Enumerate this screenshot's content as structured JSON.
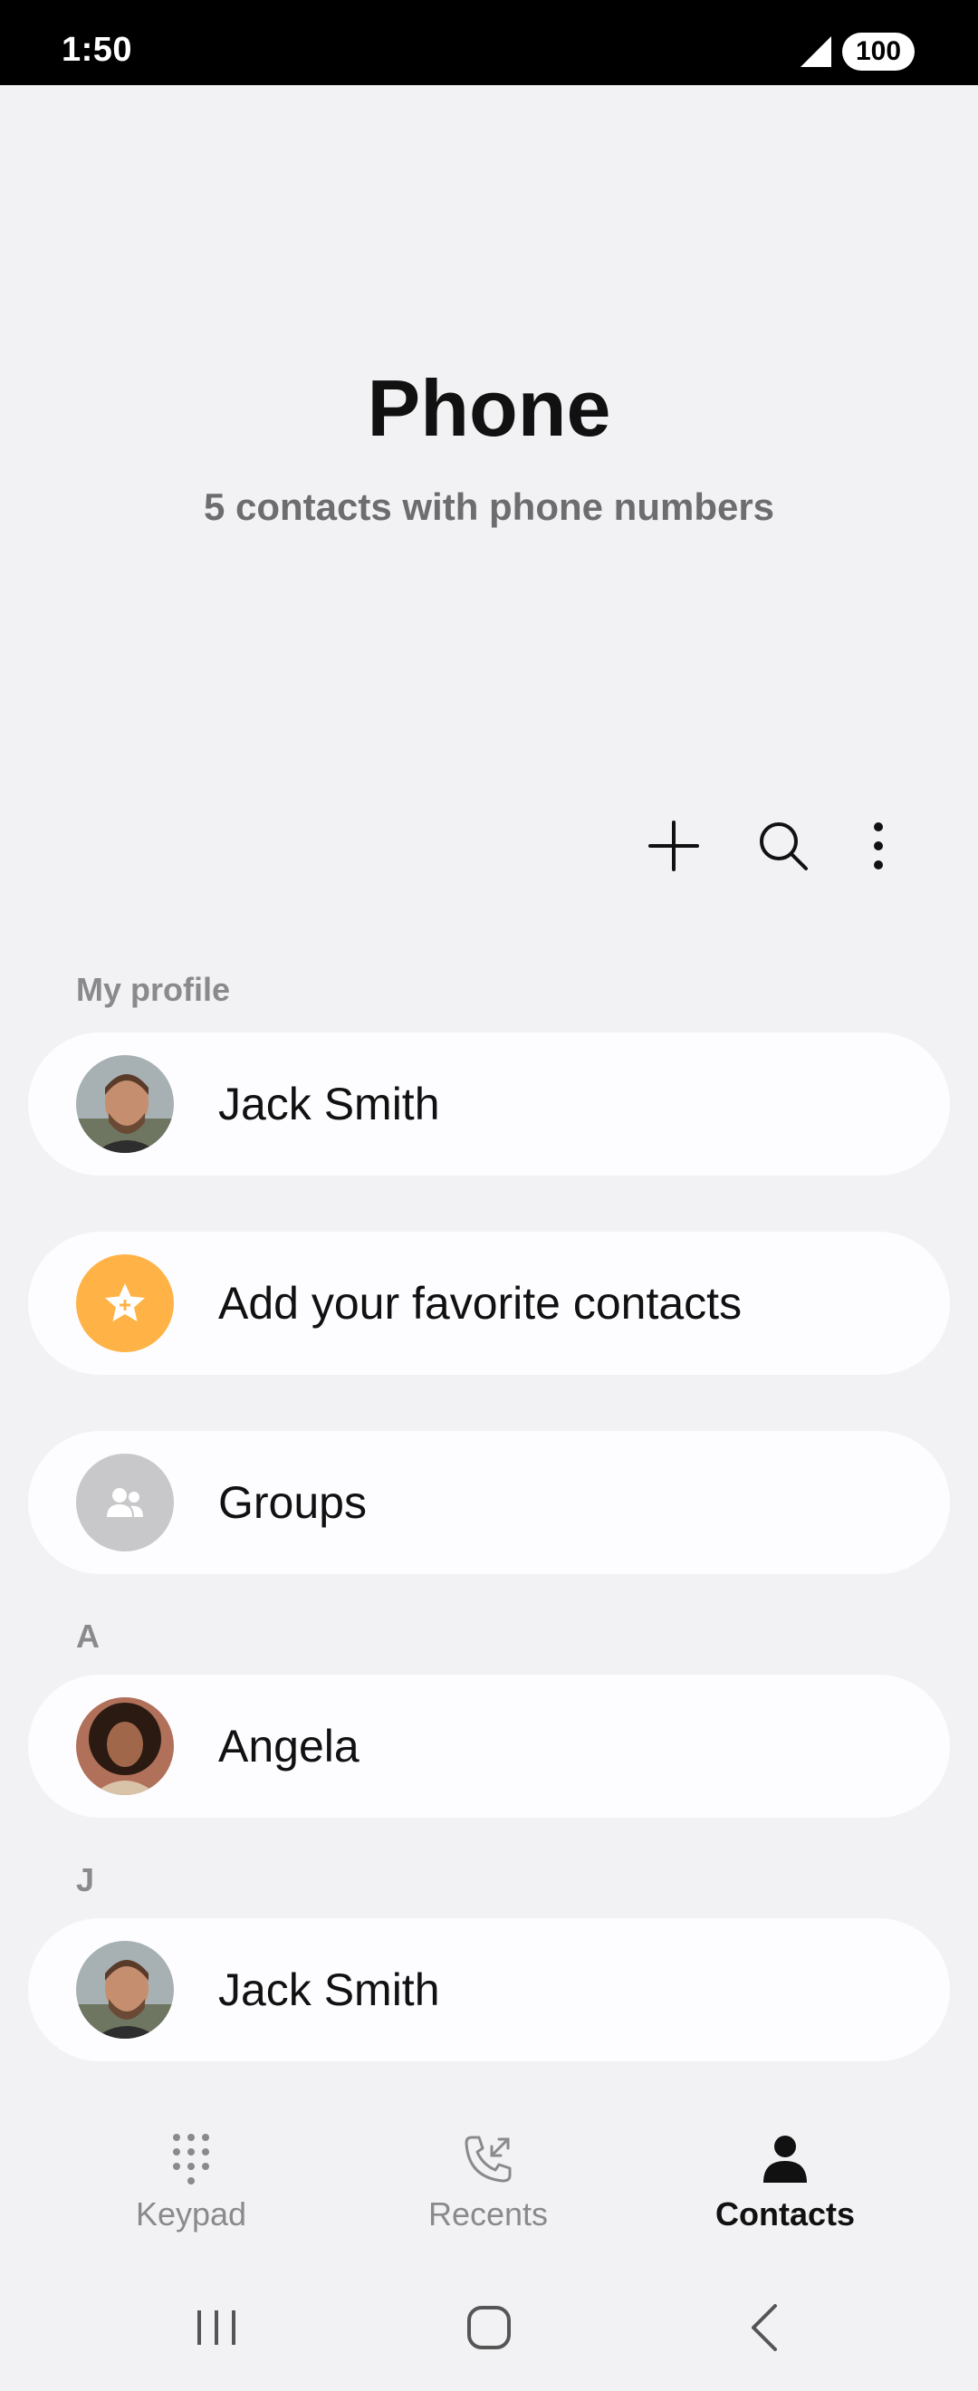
{
  "status_bar": {
    "time": "1:50",
    "battery": "100",
    "icons": [
      "signal-icon",
      "battery-icon"
    ]
  },
  "header": {
    "title": "Phone",
    "subtitle": "5 contacts with phone numbers"
  },
  "toolbar": {
    "icons": [
      "add-icon",
      "search-icon",
      "more-options-icon"
    ]
  },
  "sections": {
    "my_profile_label": "My profile",
    "a_label": "A",
    "j_label": "J"
  },
  "profile": {
    "name": "Jack Smith"
  },
  "favorites": {
    "label": "Add your favorite contacts",
    "icon": "star-icon",
    "color": "#ffb347"
  },
  "groups": {
    "label": "Groups",
    "icon": "group-icon",
    "color": "#c8c8cb"
  },
  "contacts": [
    {
      "name": "Angela"
    },
    {
      "name": "Jack Smith"
    }
  ],
  "bottom_nav": {
    "items": [
      {
        "label": "Keypad",
        "icon": "keypad-icon",
        "active": false
      },
      {
        "label": "Recents",
        "icon": "recents-icon",
        "active": false
      },
      {
        "label": "Contacts",
        "icon": "contacts-icon",
        "active": true
      }
    ]
  },
  "system_nav": {
    "icons": [
      "recent-apps-icon",
      "home-icon",
      "back-icon"
    ]
  },
  "colors": {
    "background": "#f2f2f4",
    "card": "#fdfdff",
    "accent_star": "#ffb347"
  }
}
